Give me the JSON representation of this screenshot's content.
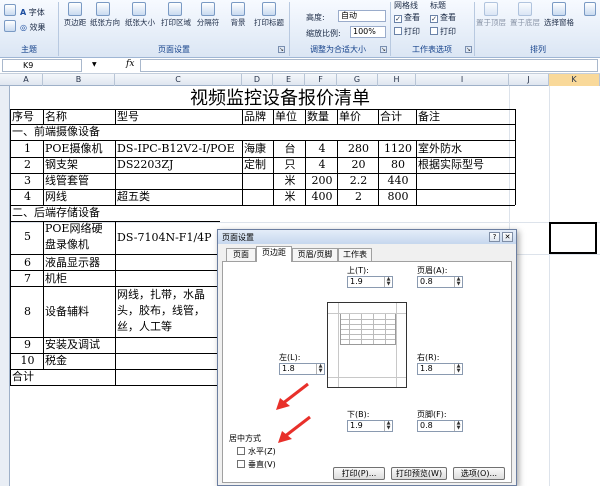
{
  "ribbon": {
    "font_btn": "字体",
    "effects_btn": "效果",
    "theme_group": "主题",
    "page_setup_buttons": [
      "页边距",
      "纸张方向",
      "纸张大小",
      "打印区域",
      "分隔符",
      "背景",
      "打印标题"
    ],
    "page_setup_group": "页面设置",
    "height_label": "高度:",
    "height_value": "自动",
    "scale_label": "缩放比例:",
    "scale_value": "100%",
    "scale_group": "调整为合适大小",
    "gridlines_label": "网格线",
    "headings_label": "标题",
    "view_label": "查看",
    "print_label": "打印",
    "sheet_options_group": "工作表选项",
    "arrange_buttons": [
      "置于顶层",
      "置于底层",
      "选择窗格"
    ],
    "arrange_group": "排列"
  },
  "formula_bar": {
    "name_box": "K9",
    "fx": "fx"
  },
  "columns": [
    "A",
    "B",
    "C",
    "D",
    "E",
    "F",
    "G",
    "H",
    "I",
    "J",
    "K"
  ],
  "sheet": {
    "title": "视频监控设备报价清单",
    "headers": [
      "序号",
      "名称",
      "型号",
      "品牌",
      "单位",
      "数量",
      "单价",
      "合计",
      "备注"
    ],
    "section1": "一、前端摄像设备",
    "rows1": [
      [
        "1",
        "POE摄像机",
        "DS-IPC-B12V2-I/POE",
        "海康",
        "台",
        "4",
        "280",
        "1120",
        "室外防水"
      ],
      [
        "2",
        "钢支架",
        "DS2203ZJ",
        "定制",
        "只",
        "4",
        "20",
        "80",
        "根据实际型号"
      ],
      [
        "3",
        "线管套管",
        "",
        "",
        "米",
        "200",
        "2.2",
        "440",
        ""
      ],
      [
        "4",
        "网线",
        "超五类",
        "",
        "米",
        "400",
        "2",
        "800",
        ""
      ]
    ],
    "section2": "二、后端存储设备",
    "row5": {
      "no": "5",
      "name1": "POE网络硬",
      "name2": "盘录像机",
      "model": "DS-7104N-F1/4P"
    },
    "row6": {
      "no": "6",
      "name": "液晶显示器"
    },
    "row7": {
      "no": "7",
      "name": "机柜"
    },
    "row8": {
      "no": "8",
      "name": "设备辅料",
      "model1": "网线，扎带，水晶",
      "model2": "头，胶布，线管，",
      "model3": "丝，人工等"
    },
    "row9": {
      "no": "9",
      "name": "安装及调试"
    },
    "row10": {
      "no": "10",
      "name": "税金"
    },
    "total": "合计"
  },
  "dialog": {
    "title": "页面设置",
    "tabs": [
      "页面",
      "页边距",
      "页眉/页脚",
      "工作表"
    ],
    "top_label": "上(T):",
    "top_value": "1.9",
    "header_label": "页眉(A):",
    "header_value": "0.8",
    "left_label": "左(L):",
    "left_value": "1.8",
    "right_label": "右(R):",
    "right_value": "1.8",
    "bottom_label": "下(B):",
    "bottom_value": "1.9",
    "footer_label": "页脚(F):",
    "footer_value": "0.8",
    "center_group": "居中方式",
    "horizontal_label": "水平(Z)",
    "vertical_label": "垂直(V)",
    "print_btn": "打印(P)...",
    "preview_btn": "打印预览(W)",
    "options_btn": "选项(O)..."
  },
  "colors": {
    "accent_blue": "#15428b",
    "annotation_red": "#e8302a"
  }
}
